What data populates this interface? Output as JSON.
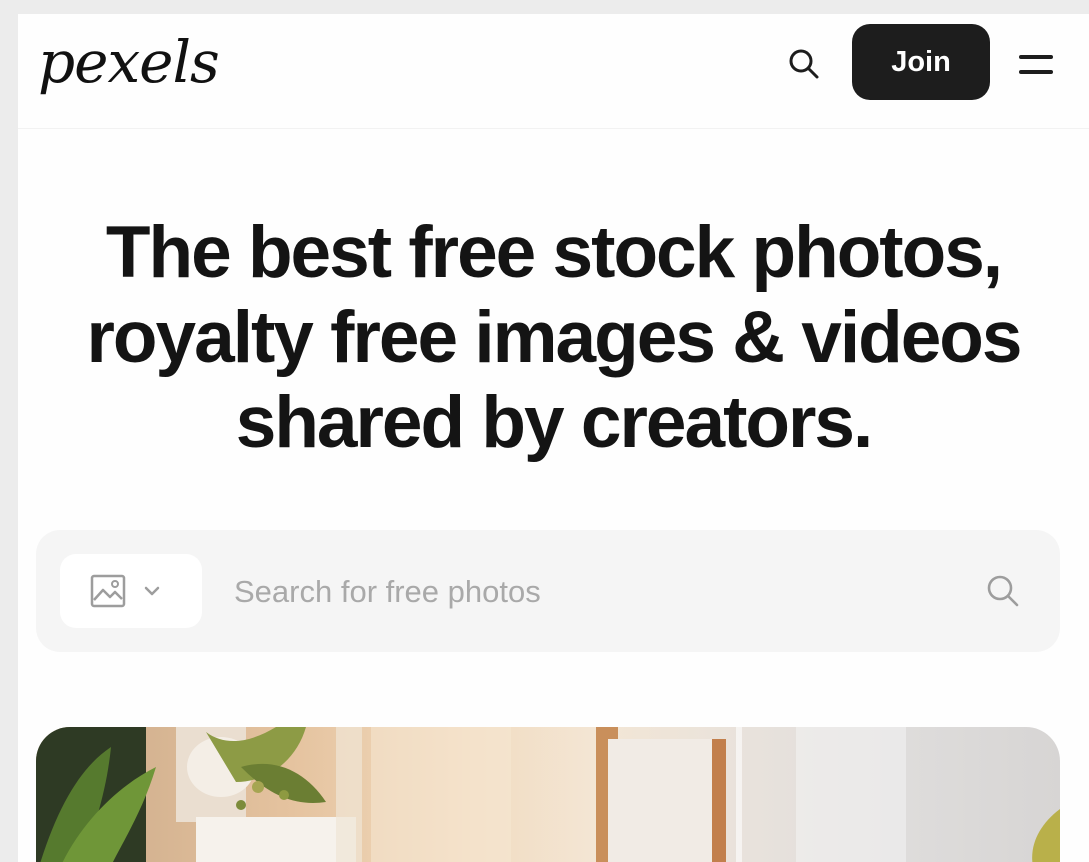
{
  "header": {
    "logo_text": "pexels",
    "search_icon": "search-icon",
    "join_label": "Join",
    "menu_icon": "menu-icon"
  },
  "hero": {
    "title_line1": "The best free stock photos,",
    "title_line2": "royalty free images & videos",
    "title_line3": "shared by creators."
  },
  "search": {
    "media_type_icon": "image-icon",
    "dropdown_icon": "chevron-down-icon",
    "placeholder": "Search for free photos",
    "submit_icon": "search-icon"
  },
  "colors": {
    "page_background": "#ffffff",
    "join_button": "#1d1d1d",
    "search_bar": "#f5f5f5",
    "placeholder_text": "#a9a9a9"
  }
}
